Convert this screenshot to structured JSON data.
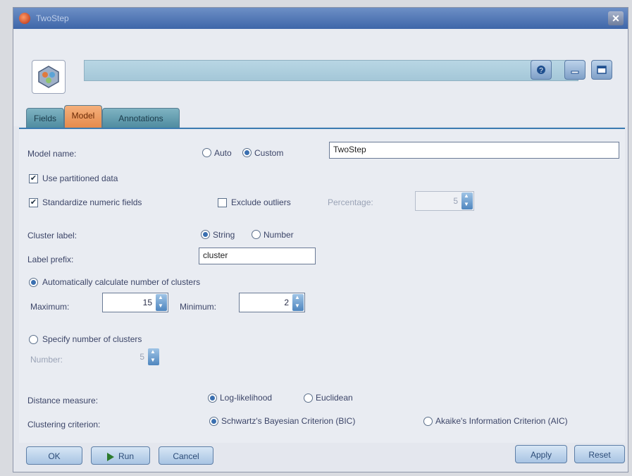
{
  "window": {
    "title": "TwoStep"
  },
  "tabs": [
    {
      "label": "Fields",
      "active": false
    },
    {
      "label": "Model",
      "active": true
    },
    {
      "label": "Annotations",
      "active": false
    }
  ],
  "model_name": {
    "label": "Model name:",
    "options": [
      "Auto",
      "Custom"
    ],
    "selected": "Custom",
    "value": "TwoStep"
  },
  "use_partitioned": {
    "label": "Use partitioned data",
    "checked": true
  },
  "standardize": {
    "label": "Standardize numeric fields",
    "checked": true
  },
  "exclude_outliers": {
    "label": "Exclude outliers",
    "checked": false,
    "percentage_label": "Percentage:",
    "percentage_value": "5"
  },
  "cluster_label": {
    "label": "Cluster label:",
    "options": [
      "String",
      "Number"
    ],
    "selected": "String"
  },
  "label_prefix": {
    "label": "Label prefix:",
    "value": "cluster"
  },
  "auto_clusters": {
    "label": "Automatically calculate number of clusters",
    "selected": true,
    "maximum_label": "Maximum:",
    "maximum_value": "15",
    "minimum_label": "Minimum:",
    "minimum_value": "2"
  },
  "specify_clusters": {
    "label": "Specify number of clusters",
    "selected": false,
    "number_label": "Number:",
    "number_value": "5"
  },
  "distance_measure": {
    "label": "Distance measure:",
    "options": [
      "Log-likelihood",
      "Euclidean"
    ],
    "selected": "Log-likelihood"
  },
  "clustering_criterion": {
    "label": "Clustering criterion:",
    "options": [
      "Schwartz's Bayesian Criterion (BIC)",
      "Akaike's Information Criterion (AIC)"
    ],
    "selected": "Schwartz's Bayesian Criterion (BIC)"
  },
  "footer": {
    "ok": "OK",
    "run": "Run",
    "cancel": "Cancel",
    "apply": "Apply",
    "reset": "Reset"
  },
  "colors": {
    "title_bar": "#4a72b2",
    "active_tab": "#e58b4c",
    "tab": "#4f8ca0",
    "accent_line": "#3b7bb1"
  }
}
